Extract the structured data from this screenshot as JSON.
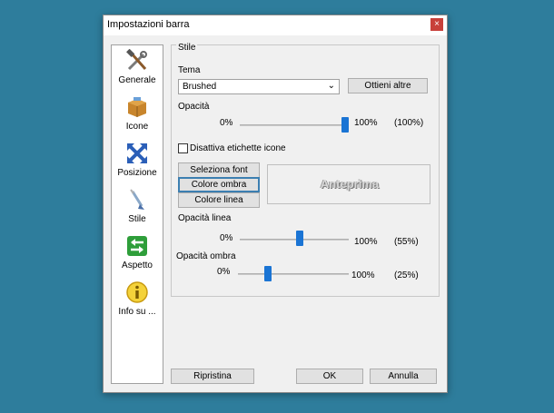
{
  "window": {
    "title": "Impostazioni barra",
    "close": "×"
  },
  "sidebar": {
    "items": [
      {
        "label": "Generale",
        "icon": "tools-icon"
      },
      {
        "label": "Icone",
        "icon": "box-icon"
      },
      {
        "label": "Posizione",
        "icon": "move-arrows-icon"
      },
      {
        "label": "Stile",
        "icon": "brush-icon"
      },
      {
        "label": "Aspetto",
        "icon": "arrows-swap-icon"
      },
      {
        "label": "Info su ...",
        "icon": "info-icon"
      }
    ]
  },
  "stile": {
    "group_title": "Stile",
    "tema_label": "Tema",
    "tema_value": "Brushed",
    "ottieni_button": "Ottieni altre",
    "opacita_label": "Opacità",
    "opacita_min": "0%",
    "opacita_max": "100%",
    "opacita_value": "(100%)",
    "opacita_fraction": 1.0,
    "disattiva_label": "Disattiva etichette icone",
    "seleziona_font": "Seleziona font",
    "colore_ombra": "Colore ombra",
    "colore_linea": "Colore linea",
    "anteprima": "Anteprima",
    "opacita_linea_label": "Opacità linea",
    "opacita_linea_min": "0%",
    "opacita_linea_max": "100%",
    "opacita_linea_value": "(55%)",
    "opacita_linea_fraction": 0.55,
    "opacita_ombra_label": "Opacità ombra",
    "opacita_ombra_min": "0%",
    "opacita_ombra_max": "100%",
    "opacita_ombra_value": "(25%)",
    "opacita_ombra_fraction": 0.25
  },
  "footer": {
    "ripristina": "Ripristina",
    "ok": "OK",
    "annulla": "Annulla"
  },
  "colors": {
    "background": "#2e7d9c",
    "slider_thumb": "#1a74d4",
    "close_button": "#c8403a"
  }
}
